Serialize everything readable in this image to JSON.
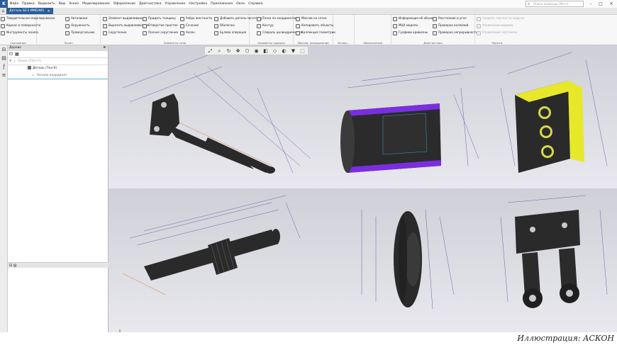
{
  "app": {
    "logo": "K"
  },
  "menu": [
    "Файл",
    "Правка",
    "Выделить",
    "Вид",
    "Эскиз",
    "Моделирование",
    "Оформление",
    "Диагностика",
    "Управление",
    "Настройка",
    "Приложения",
    "Окно",
    "Справка"
  ],
  "search": {
    "placeholder": "Поиск команды (Alt+/)"
  },
  "tab": {
    "title": "Деталь БЕЗ ИМЕНИ1"
  },
  "ribbon": {
    "left_tools": [
      "Твердотельное моделирование",
      "Каркас и поверхности",
      "Инструменты эскиза"
    ],
    "sketch_tools": [
      "Автолиния",
      "Окружность",
      "Прямоугольник"
    ],
    "body_col1": [
      "Элемент выдавливания",
      "Вырезать выдавливанием",
      "Скругление"
    ],
    "body_col2": [
      "Придать толщину",
      "Отверстие простое",
      "Полное скругление"
    ],
    "body_col3": [
      "Ребро жесткости",
      "Сечение",
      "Уклон"
    ],
    "body_col4": [
      "Добавить деталь-заготовку",
      "Оболочка",
      "Булева операция"
    ],
    "frame_tools": [
      "Точка по координатам",
      "Контур",
      "Спираль цилиндрическая..."
    ],
    "array_tools": [
      "Массив по сетке",
      "Копировать объекты",
      "Коллекция геометрии"
    ],
    "mark_tools": [
      "МЦХ модели"
    ],
    "diag_col1": [
      "Информация об объекте",
      "МЦХ модели",
      "Графики кривизны"
    ],
    "diag_col2": [
      "Расстояние и угол",
      "Проверка коллизий",
      "Проверка непрерывности"
    ],
    "draft_tools": [
      "Создать чертеж по модели",
      "Управление видами",
      "Управление чертежом"
    ],
    "groups": [
      "Системная",
      "Эскиз",
      "Элементы тела",
      "Элементы каркаса",
      "Массив, копирование",
      "Вспом...",
      "Обозначения",
      "Диагностика",
      "Чертеж"
    ]
  },
  "tree": {
    "title": "Дерево",
    "search_placeholder": "Поиск (Ctrl+F)",
    "root": "Деталь (Тел-0)",
    "child": "Начало координат"
  },
  "caption": "Иллюстрация: АСКОН",
  "colors": {
    "accent": "#2c5d99",
    "section_purple": "#7b2ee0",
    "section_yellow": "#e8e82a",
    "dim_line": "#6e62a8",
    "dim_orange": "#e0782a"
  },
  "icons": [
    "home-icon",
    "search-icon",
    "filter-icon",
    "pin-icon",
    "close-icon",
    "minimize-icon",
    "maximize-icon"
  ]
}
